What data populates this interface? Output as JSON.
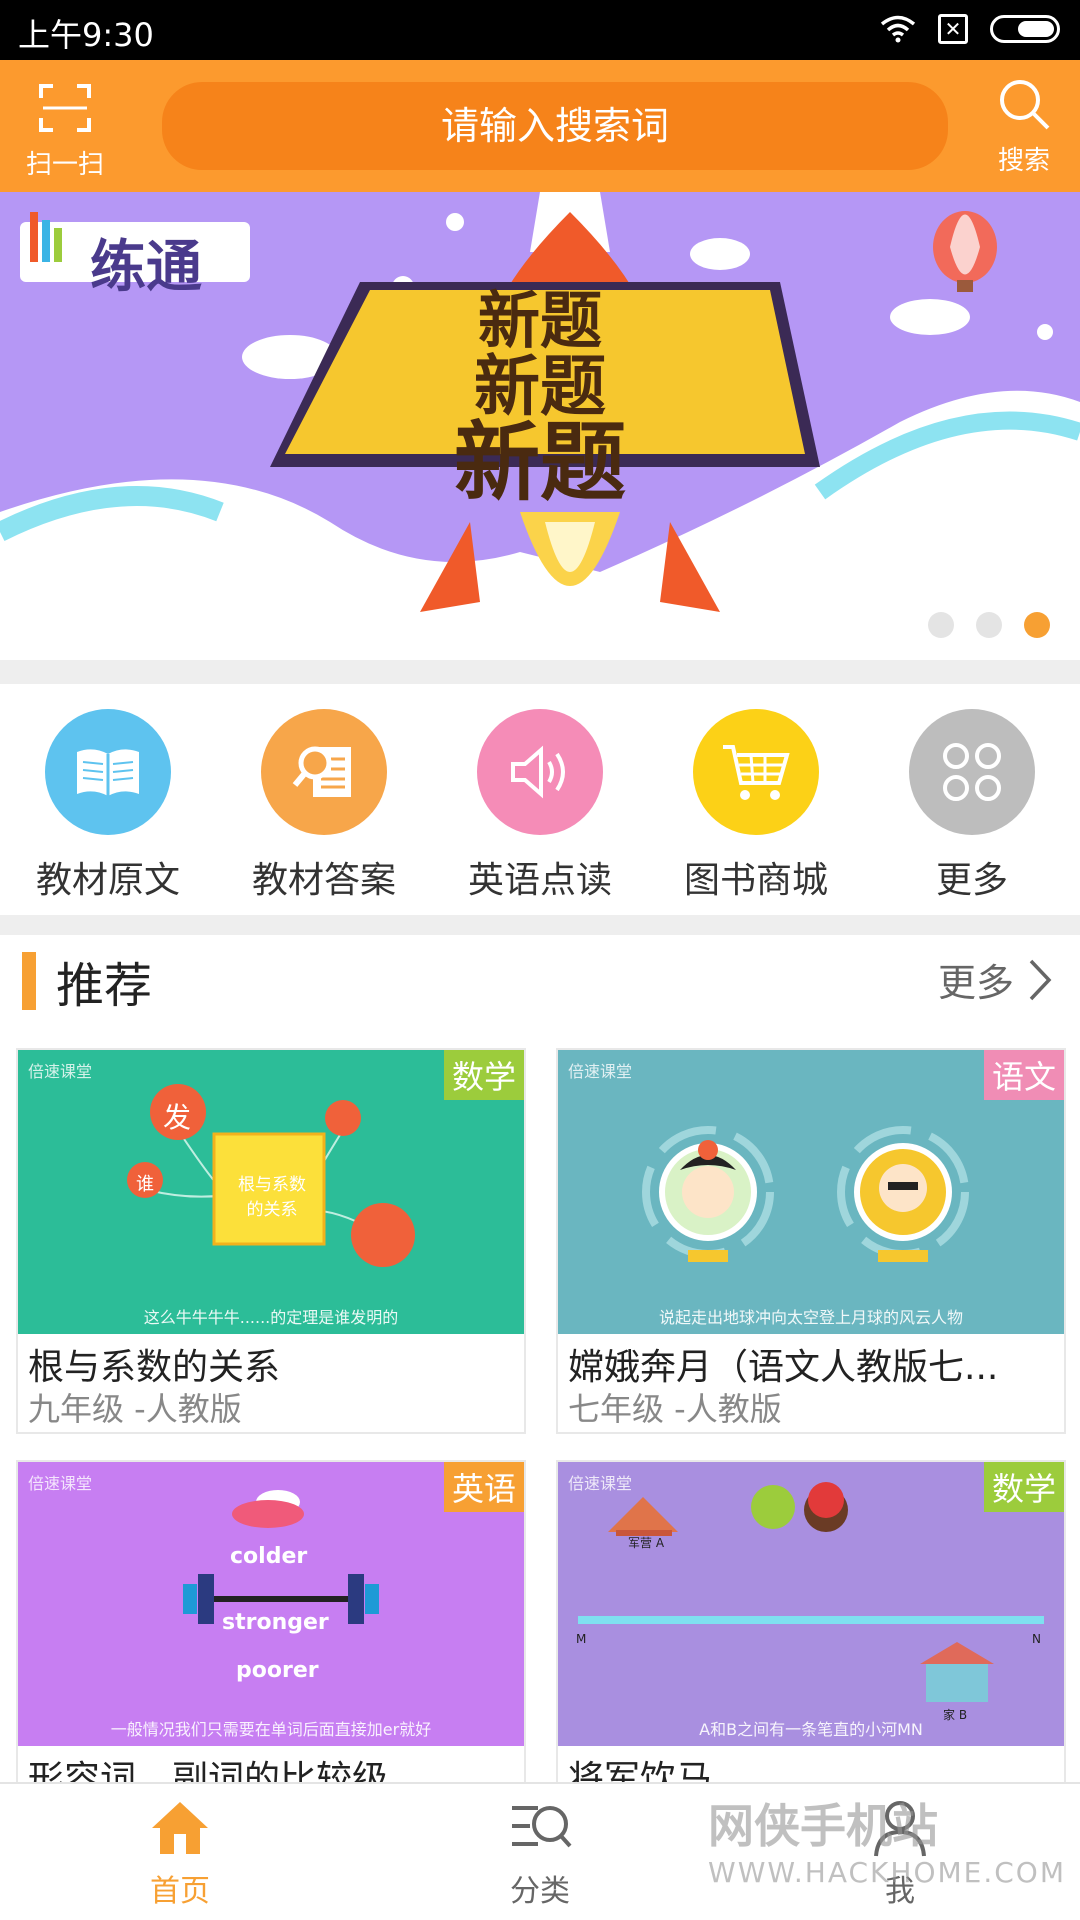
{
  "status": {
    "time": "上午9:30"
  },
  "header": {
    "scan_label": "扫一扫",
    "search_placeholder": "请输入搜索词",
    "search_label": "搜索"
  },
  "banner": {
    "logo_text": "练通",
    "headline": "新题",
    "slide_count": 3,
    "active_slide": 3
  },
  "quick_nav": [
    {
      "label": "教材原文",
      "icon": "book-icon",
      "color": "#5ec3ef"
    },
    {
      "label": "教材答案",
      "icon": "magnifier-document-icon",
      "color": "#f7a64a"
    },
    {
      "label": "英语点读",
      "icon": "speaker-icon",
      "color": "#f58cb7"
    },
    {
      "label": "图书商城",
      "icon": "cart-icon",
      "color": "#fcd117"
    },
    {
      "label": "更多",
      "icon": "more-grid-icon",
      "color": "#bdbdbd"
    }
  ],
  "recommend": {
    "title": "推荐",
    "more": "更多",
    "items": [
      {
        "subject": "数学",
        "subject_color": "#9ccc3c",
        "bg": "#2cbd98",
        "watermark": "倍速课堂",
        "caption": "这么牛牛牛牛......的定理是谁发明的",
        "thumb_text": "根与系数的关系",
        "bubble_1": "发",
        "bubble_2": "谁",
        "title": "根与系数的关系",
        "meta": "九年级 -人教版"
      },
      {
        "subject": "语文",
        "subject_color": "#f08db5",
        "bg": "#6ab6c0",
        "watermark": "倍速课堂",
        "caption": "说起走出地球冲向太空登上月球的风云人物",
        "title": "嫦娥奔月（语文人教版七...",
        "meta": "七年级 -人教版"
      },
      {
        "subject": "英语",
        "subject_color": "#f7a033",
        "bg": "#c77ef2",
        "watermark": "倍速课堂",
        "caption": "一般情况我们只需要在单词后面直接加er就好",
        "words": [
          "colder",
          "stronger",
          "poorer"
        ],
        "title": "形容词、副词的比较级",
        "meta": ""
      },
      {
        "subject": "数学",
        "subject_color": "#9ccc3c",
        "bg": "#a98fe0",
        "watermark": "倍速课堂",
        "caption": "A和B之间有一条笔直的小河MN",
        "point_a": "军营 A",
        "point_b": "家 B",
        "point_m": "M",
        "point_n": "N",
        "title": "将军饮马",
        "meta": ""
      }
    ]
  },
  "bottom_nav": [
    {
      "label": "首页",
      "icon": "home-icon",
      "active": true
    },
    {
      "label": "分类",
      "icon": "category-search-icon",
      "active": false
    },
    {
      "label": "我",
      "icon": "profile-icon",
      "active": false
    }
  ],
  "site_watermark": {
    "name": "网侠手机站",
    "url": "WWW.HACKHOME.COM"
  }
}
